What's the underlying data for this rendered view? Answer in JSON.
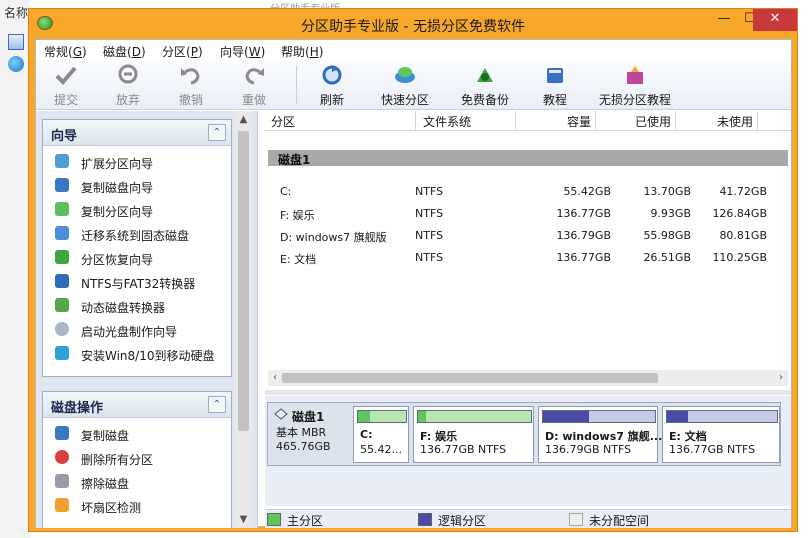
{
  "desktop": {
    "label": "名称",
    "top_fragment": "分区助手专业版"
  },
  "window": {
    "title": "分区助手专业版 - 无损分区免费软件",
    "controls": {
      "minimize": "—",
      "maximize": "☐",
      "close": "✕"
    }
  },
  "menu": [
    {
      "label": "常规",
      "key": "G"
    },
    {
      "label": "磁盘",
      "key": "D"
    },
    {
      "label": "分区",
      "key": "P"
    },
    {
      "label": "向导",
      "key": "W"
    },
    {
      "label": "帮助",
      "key": "H"
    }
  ],
  "toolbar": {
    "commit": "提交",
    "discard": "放弃",
    "undo": "撤销",
    "redo": "重做",
    "refresh": "刷新",
    "quick_partition": "快速分区",
    "free_backup": "免费备份",
    "tutorial": "教程",
    "lossless_tutorial": "无损分区教程"
  },
  "wizard_panel": {
    "title": "向导",
    "items": [
      "扩展分区向导",
      "复制磁盘向导",
      "复制分区向导",
      "迁移系统到固态磁盘",
      "分区恢复向导",
      "NTFS与FAT32转换器",
      "动态磁盘转换器",
      "启动光盘制作向导",
      "安装Win8/10到移动硬盘"
    ]
  },
  "disk_ops_panel": {
    "title": "磁盘操作",
    "items": [
      "复制磁盘",
      "删除所有分区",
      "擦除磁盘",
      "坏扇区检测"
    ]
  },
  "table": {
    "headers": {
      "partition": "分区",
      "filesystem": "文件系统",
      "capacity": "容量",
      "used": "已使用",
      "free": "未使用"
    },
    "disk_label": "磁盘1",
    "rows": [
      {
        "name": "C:",
        "fs": "NTFS",
        "capacity": "55.42GB",
        "used": "13.70GB",
        "free": "41.72GB"
      },
      {
        "name": "F: 娱乐",
        "fs": "NTFS",
        "capacity": "136.77GB",
        "used": "9.93GB",
        "free": "126.84GB"
      },
      {
        "name": "D: windows7 旗舰版",
        "fs": "NTFS",
        "capacity": "136.79GB",
        "used": "55.98GB",
        "free": "80.81GB"
      },
      {
        "name": "E: 文档",
        "fs": "NTFS",
        "capacity": "136.77GB",
        "used": "26.51GB",
        "free": "110.25GB"
      }
    ]
  },
  "disk_map": {
    "name": "磁盘1",
    "type": "基本 MBR",
    "size": "465.76GB",
    "partitions": [
      {
        "label": "C:",
        "detail": "55.42...",
        "color": "#5fc75a",
        "fill_fraction": 0.25
      },
      {
        "label": "F: 娱乐",
        "detail": "136.77GB NTFS",
        "color": "#5fc75a",
        "fill_fraction": 0.07
      },
      {
        "label": "D: windows7 旗舰...",
        "detail": "136.79GB NTFS",
        "color": "#4a4aa8",
        "fill_fraction": 0.41
      },
      {
        "label": "E: 文档",
        "detail": "136.77GB NTFS",
        "color": "#4a4aa8",
        "fill_fraction": 0.19
      }
    ]
  },
  "legend": {
    "primary": "主分区",
    "logical": "逻辑分区",
    "unallocated": "未分配空间"
  },
  "colors": {
    "title_bar": "#f7a72a",
    "primary": "#5fc75a",
    "logical": "#4a4aa8",
    "unallocated": "#eeeeee"
  }
}
